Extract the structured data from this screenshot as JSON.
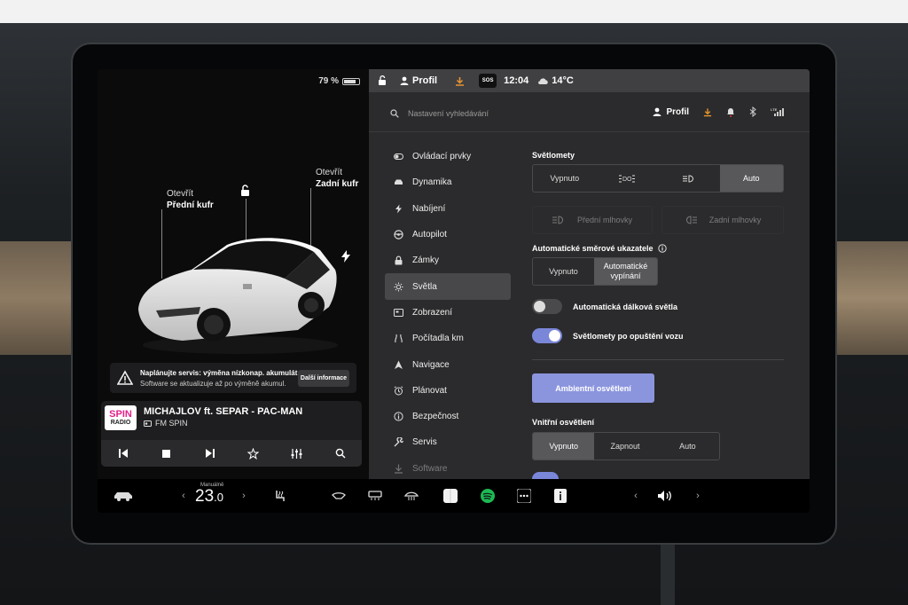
{
  "left_panel": {
    "battery_percent": "79 %",
    "battery_level": 0.79,
    "front_trunk": {
      "state": "Otevřít",
      "name": "Přední kufr"
    },
    "rear_trunk": {
      "state": "Otevřít",
      "name": "Zadní kufr"
    },
    "service_alert": {
      "title": "Naplánujte servis: výměna nízkonap. akumulát…",
      "subtitle": "Software se aktualizuje až po výměně akumul.",
      "button": "Další informace"
    },
    "media": {
      "logo_top": "SPIN",
      "logo_bottom": "RADIO",
      "song": "MICHAJLOV ft. SEPAR - PAC-MAN",
      "station": "FM SPIN"
    }
  },
  "status_bar": {
    "profile": "Profil",
    "sos": "SOS",
    "time": "12:04",
    "temperature": "14°C"
  },
  "search": {
    "placeholder": "Nastavení vyhledávání"
  },
  "top_right": {
    "profile": "Profil"
  },
  "menu": {
    "items": [
      {
        "label": "Ovládací prvky",
        "icon": "toggle-icon"
      },
      {
        "label": "Dynamika",
        "icon": "car-icon"
      },
      {
        "label": "Nabíjení",
        "icon": "bolt-icon"
      },
      {
        "label": "Autopilot",
        "icon": "steering-wheel-icon"
      },
      {
        "label": "Zámky",
        "icon": "lock-icon"
      },
      {
        "label": "Světla",
        "icon": "sun-icon"
      },
      {
        "label": "Zobrazení",
        "icon": "display-icon"
      },
      {
        "label": "Počítadla km",
        "icon": "trip-icon"
      },
      {
        "label": "Navigace",
        "icon": "navigation-icon"
      },
      {
        "label": "Plánovat",
        "icon": "alarm-icon"
      },
      {
        "label": "Bezpečnost",
        "icon": "info-icon"
      },
      {
        "label": "Servis",
        "icon": "wrench-icon"
      },
      {
        "label": "Software",
        "icon": "download-icon"
      }
    ],
    "active_index": 5
  },
  "lights": {
    "headlights_label": "Světlomety",
    "headlights_options": [
      "Vypnuto",
      "",
      "",
      "Auto"
    ],
    "headlights_selected": 3,
    "front_fog": "Přední mlhovky",
    "rear_fog": "Zadní mlhovky",
    "auto_turn_label": "Automatické směrové ukazatele",
    "auto_turn_options": [
      "Vypnuto",
      "Automatické vypínání"
    ],
    "auto_turn_selected": 1,
    "auto_high_beam": "Automatická dálková světla",
    "auto_high_beam_on": false,
    "headlights_after_exit": "Světlomety po opuštění vozu",
    "headlights_after_exit_on": true,
    "ambient_button": "Ambientní osvětlení",
    "interior_label": "Vnitřní osvětlení",
    "interior_options": [
      "Vypnuto",
      "Zapnout",
      "Auto"
    ],
    "interior_selected": 0
  },
  "bottom_bar": {
    "climate_mode": "Manuálně",
    "temperature_int": "23",
    "temperature_dec": ".0"
  },
  "colors": {
    "accent": "#8b95de",
    "toggle_on": "#7a86d8",
    "download_orange": "#e8962e",
    "spotify_green": "#1db954"
  }
}
